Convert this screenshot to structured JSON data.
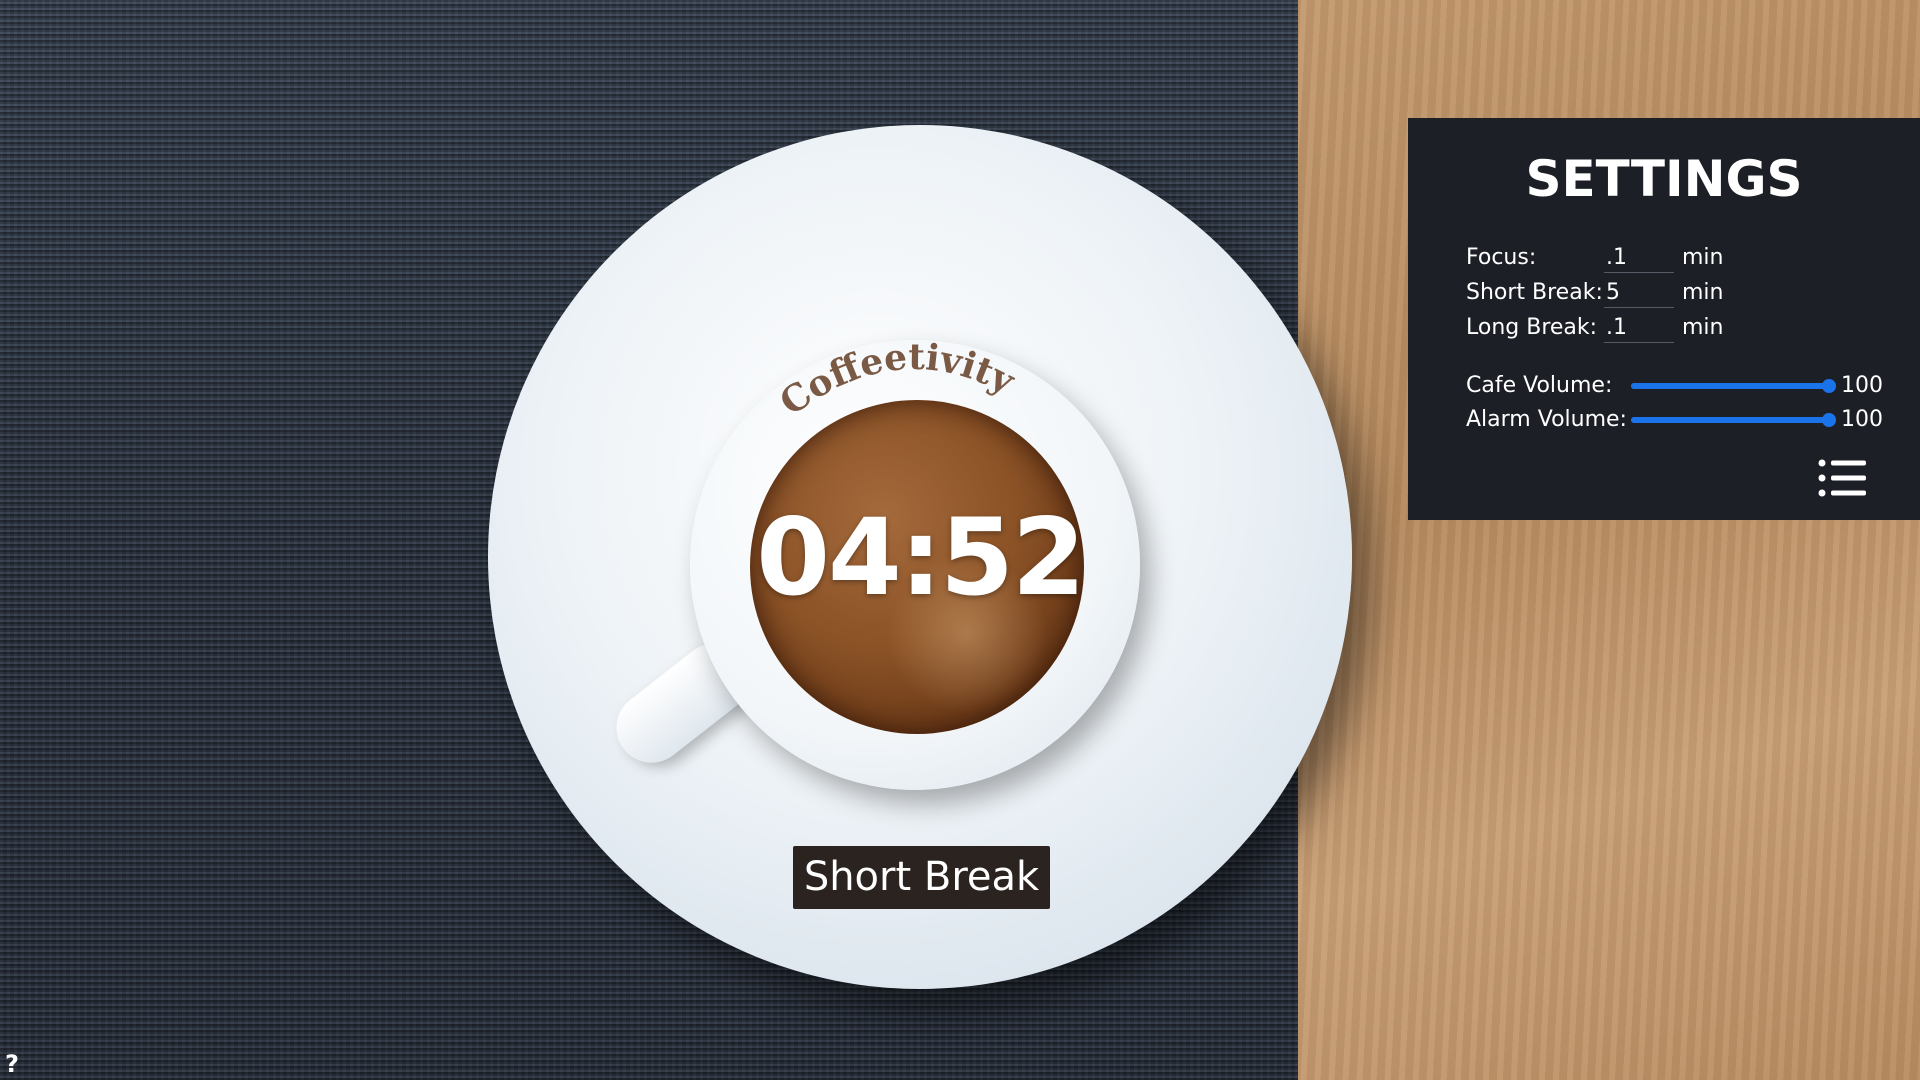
{
  "brand": {
    "name": "Coffeetivity"
  },
  "timer": {
    "display": "04:52",
    "mode": "Short Break"
  },
  "settings": {
    "title": "SETTINGS",
    "fields": [
      {
        "label": "Focus:",
        "value": ".1",
        "unit": "min"
      },
      {
        "label": "Short Break:",
        "value": "5",
        "unit": "min"
      },
      {
        "label": "Long Break:",
        "value": ".1",
        "unit": "min"
      }
    ],
    "volumes": [
      {
        "label": "Cafe Volume:",
        "value": "100",
        "level": 1.0
      },
      {
        "label": "Alarm Volume:",
        "value": "100",
        "level": 1.0
      }
    ],
    "menu_icon": "list-icon"
  },
  "help": {
    "label": "?"
  },
  "colors": {
    "accent": "#1a73e8",
    "panel_bg": "#1d1f27",
    "badge_bg": "#2b2320",
    "brand_text": "#7a5a45"
  }
}
